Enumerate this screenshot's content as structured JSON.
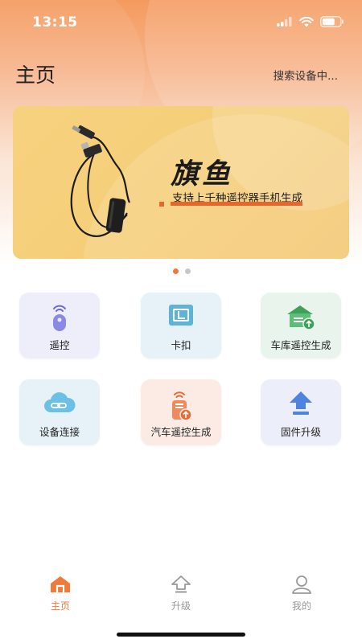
{
  "status_bar": {
    "time": "13:15"
  },
  "header": {
    "title": "主页",
    "search_status": "搜索设备中..."
  },
  "banner": {
    "brand": "旗鱼",
    "slogan": "支持上千种遥控器手机生成"
  },
  "carousel": {
    "pages": 2,
    "active_index": 0
  },
  "features": [
    {
      "label": "遥控",
      "icon": "remote-icon"
    },
    {
      "label": "卡扣",
      "icon": "card-icon"
    },
    {
      "label": "车库遥控生成",
      "icon": "garage-icon"
    },
    {
      "label": "设备连接",
      "icon": "cloud-link-icon"
    },
    {
      "label": "汽车遥控生成",
      "icon": "car-remote-icon"
    },
    {
      "label": "固件升级",
      "icon": "firmware-upgrade-icon"
    }
  ],
  "tabbar": [
    {
      "label": "主页",
      "icon": "home-icon",
      "active": true
    },
    {
      "label": "升级",
      "icon": "upgrade-icon",
      "active": false
    },
    {
      "label": "我的",
      "icon": "user-icon",
      "active": false
    }
  ],
  "colors": {
    "accent": "#ef7a3a",
    "banner": "#f5cd78"
  }
}
